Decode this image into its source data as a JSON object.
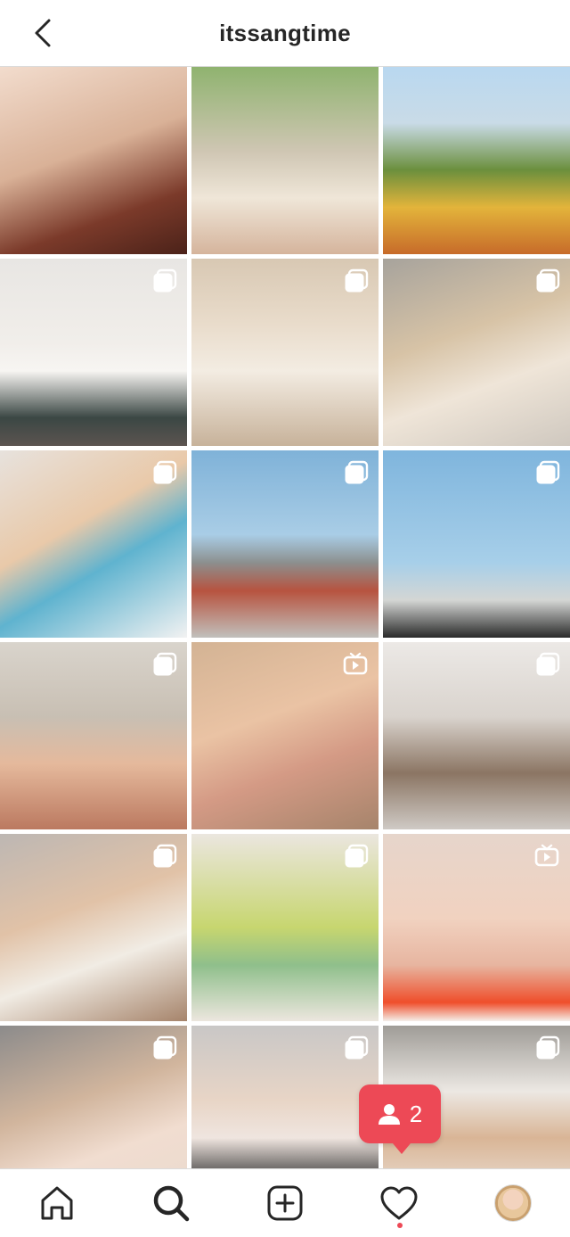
{
  "header": {
    "title": "itssangtime",
    "back_icon": "chevron-left-icon"
  },
  "grid": {
    "rows": 6,
    "columns": 3,
    "tiles": [
      {
        "badge": "none"
      },
      {
        "badge": "none"
      },
      {
        "badge": "none"
      },
      {
        "badge": "carousel"
      },
      {
        "badge": "carousel"
      },
      {
        "badge": "carousel"
      },
      {
        "badge": "carousel"
      },
      {
        "badge": "carousel"
      },
      {
        "badge": "carousel"
      },
      {
        "badge": "carousel"
      },
      {
        "badge": "igtv"
      },
      {
        "badge": "carousel"
      },
      {
        "badge": "carousel"
      },
      {
        "badge": "carousel"
      },
      {
        "badge": "igtv"
      },
      {
        "badge": "carousel"
      },
      {
        "badge": "carousel"
      },
      {
        "badge": "carousel"
      }
    ]
  },
  "activity_toast": {
    "count": "2",
    "icon": "person-icon",
    "color": "#ed4956"
  },
  "bottom_nav": {
    "items": [
      {
        "name": "home",
        "icon": "home-icon"
      },
      {
        "name": "search",
        "icon": "search-icon",
        "active": true
      },
      {
        "name": "new-post",
        "icon": "plus-square-icon"
      },
      {
        "name": "activity",
        "icon": "heart-icon"
      },
      {
        "name": "profile",
        "icon": "avatar"
      }
    ]
  }
}
